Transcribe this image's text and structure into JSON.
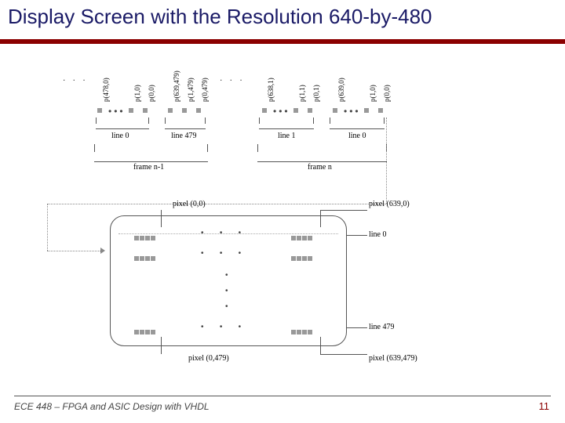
{
  "title": "Display Screen with the Resolution 640-by-480",
  "footer": "ECE 448 – FPGA and ASIC Design with VHDL",
  "page_number": "11",
  "timing_strip": {
    "leading_dots": ". . .",
    "groups": [
      {
        "pixels": [
          "p(478,0)",
          "p(1,0)",
          "p(0,0)"
        ],
        "line_label": "line 0"
      },
      {
        "pixels": [
          "p(639,479)",
          "p(1,479)",
          "p(0,479)"
        ],
        "line_label": "line 479"
      },
      {
        "pixels": [
          "p(638,1)",
          "p(1,1)",
          "p(0,1)"
        ],
        "line_label": "line 1"
      },
      {
        "pixels": [
          "p(639,0)",
          "p(1,0)",
          "p(0,0)"
        ],
        "line_label": "line 0"
      }
    ],
    "mid_dots": ". . .",
    "frames": {
      "left": "frame n-1",
      "right": "frame n"
    }
  },
  "screen": {
    "top_left_pixel": "pixel (0,0)",
    "top_right_pixel": "pixel (639,0)",
    "line_top": "line 0",
    "line_bottom": "line 479",
    "bottom_left_pixel": "pixel (0,479)",
    "bottom_right_pixel": "pixel (639,479)"
  }
}
